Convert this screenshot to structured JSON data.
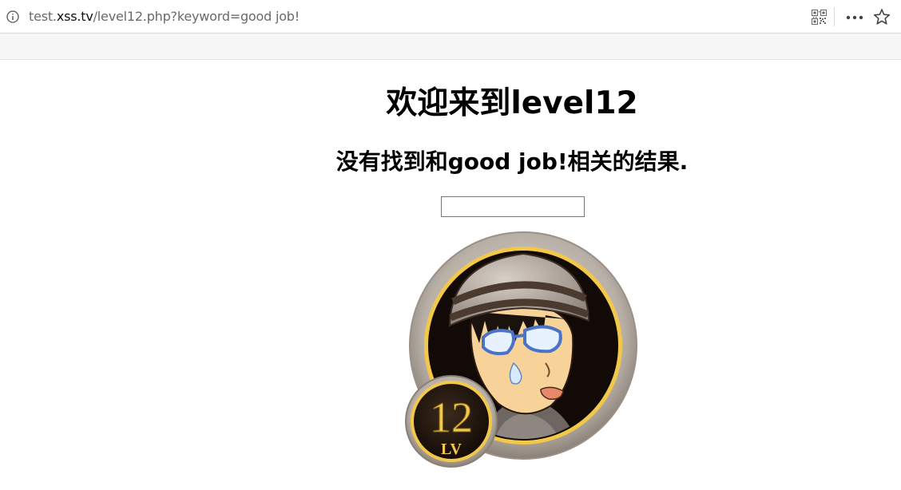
{
  "browser": {
    "url_prefix": "test.",
    "url_domain": "xss.tv",
    "url_path": "/level12.php?keyword=good job!",
    "icons": [
      "info-icon",
      "qr-code-icon",
      "more-icon",
      "bookmark-star-icon"
    ]
  },
  "page": {
    "heading": "欢迎来到level12",
    "result_message": "没有找到和good job!相关的结果.",
    "search": {
      "value": "",
      "placeholder": ""
    },
    "badge": {
      "level_number": "12",
      "level_label": "LV"
    }
  },
  "colors": {
    "badge_gold": "#f2c84b",
    "badge_ring": "#b8b0a6",
    "avatar_background": "#120a06"
  }
}
